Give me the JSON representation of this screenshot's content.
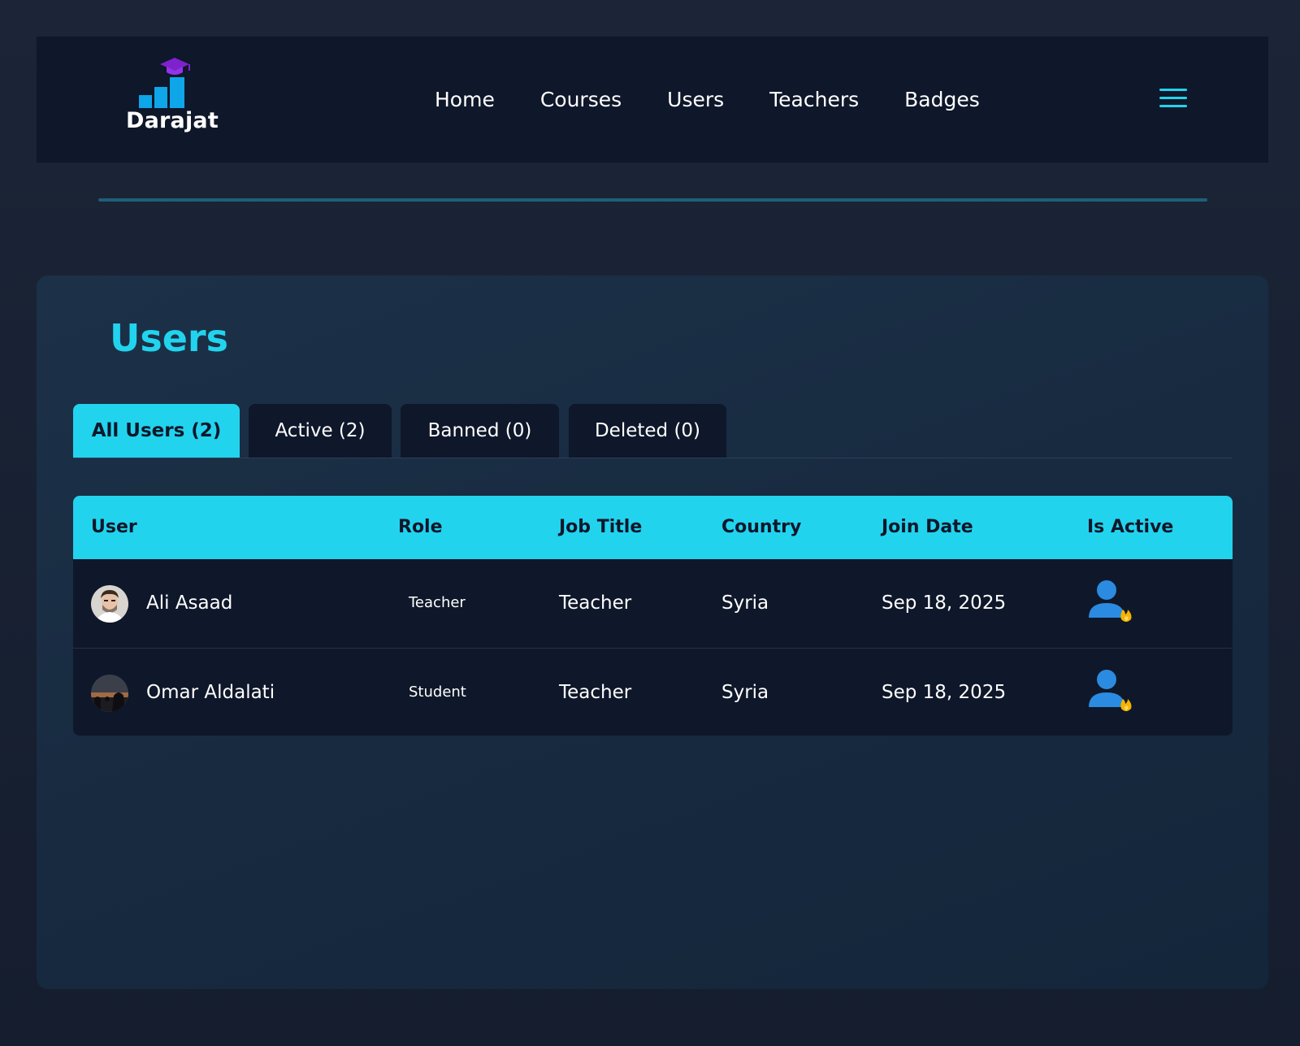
{
  "brand": {
    "name": "Darajat"
  },
  "nav": {
    "links": [
      "Home",
      "Courses",
      "Users",
      "Teachers",
      "Badges"
    ]
  },
  "page": {
    "title": "Users"
  },
  "tabs": [
    {
      "label": "All Users (2)",
      "active": true
    },
    {
      "label": "Active (2)",
      "active": false
    },
    {
      "label": "Banned (0)",
      "active": false
    },
    {
      "label": "Deleted (0)",
      "active": false
    }
  ],
  "table": {
    "columns": [
      "User",
      "Role",
      "Job Title",
      "Country",
      "Join Date",
      "Is Active"
    ],
    "rows": [
      {
        "name": "Ali Asaad",
        "role": "Teacher",
        "job_title": "Teacher",
        "country": "Syria",
        "join_date": "Sep 18, 2025",
        "status_icon": "user-active-icon"
      },
      {
        "name": "Omar Aldalati",
        "role": "Student",
        "job_title": "Teacher",
        "country": "Syria",
        "join_date": "Sep 18, 2025",
        "status_icon": "user-active-icon"
      }
    ]
  },
  "colors": {
    "accent": "#22d3ee",
    "navbar_bg": "#0f172a",
    "logo_bars": "#0ea5e9",
    "logo_cap": "#7e22ce"
  }
}
